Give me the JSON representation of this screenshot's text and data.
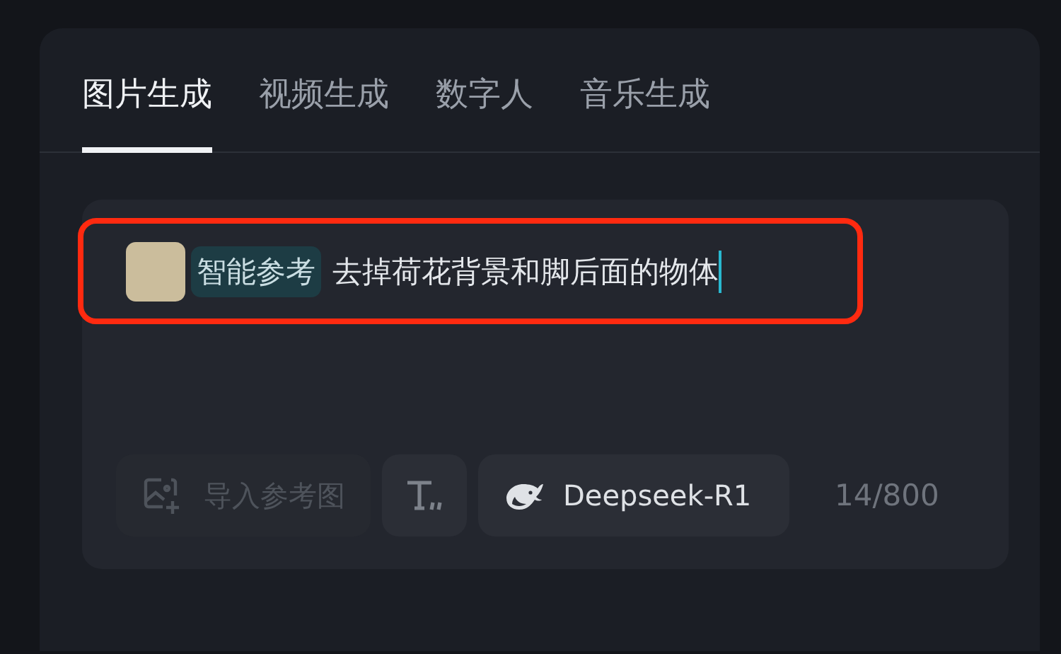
{
  "tabs": [
    {
      "label": "图片生成",
      "selected": true
    },
    {
      "label": "视频生成",
      "selected": false
    },
    {
      "label": "数字人",
      "selected": false
    },
    {
      "label": "音乐生成",
      "selected": false
    }
  ],
  "prompt": {
    "reference_chip": "智能参考",
    "value": "去掉荷花背景和脚后面的物体",
    "highlighted": true
  },
  "toolbar": [
    {
      "kind": "import",
      "label": "导入参考图",
      "disabled": true
    },
    {
      "kind": "text-style",
      "disabled": false
    },
    {
      "kind": "model",
      "label": "Deepseek-R1",
      "disabled": false
    }
  ],
  "char_count": "14/800"
}
